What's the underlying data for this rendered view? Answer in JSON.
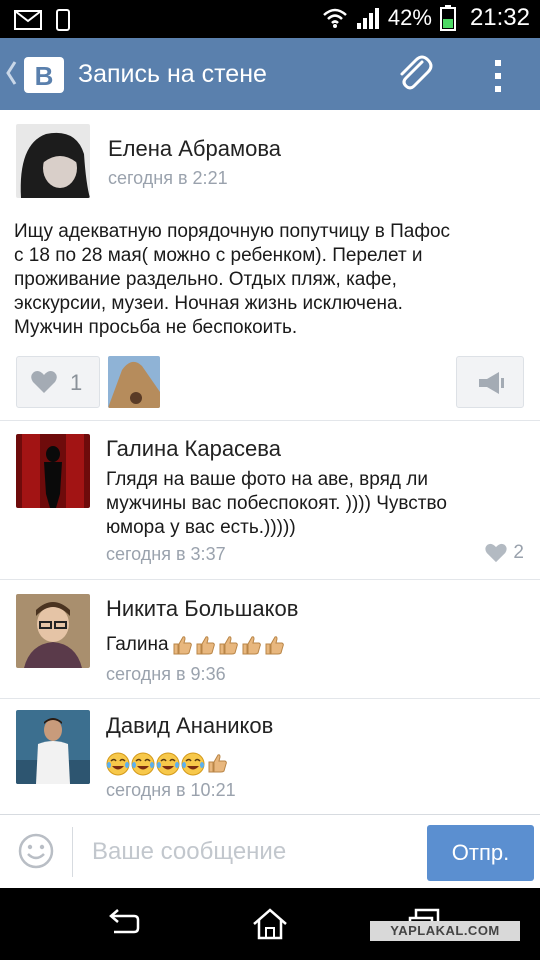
{
  "status_bar": {
    "battery": "42%",
    "clock": "21:32"
  },
  "header": {
    "title": "Запись на стене",
    "logo_letter": "B"
  },
  "post": {
    "author": "Елена Абрамова",
    "time": "сегодня в 2:21",
    "text_lines": [
      "Ищу адекватную порядочную попутчицу в Пафос",
      "с 18 по 28 мая( можно с ребенком). Перелет и",
      "проживание раздельно. Отдых пляж, кафе,",
      "экскурсии, музеи.  Ночная жизнь исключена.",
      "Мужчин просьба не беспокоить."
    ],
    "like_count": "1"
  },
  "comments": [
    {
      "author": "Галина Карасева",
      "text_lines": [
        "Глядя на ваше фото на аве, вряд ли",
        "мужчины вас побеспокоят. )))) Чувство",
        "юмора у вас есть.)))))"
      ],
      "time": "сегодня в 3:37",
      "likes": "2"
    },
    {
      "author": "Никита Большаков",
      "text": "Галина",
      "emoji": [
        "thumbs-up",
        "thumbs-up",
        "thumbs-up",
        "thumbs-up",
        "thumbs-up"
      ],
      "time": "сегодня в 9:36"
    },
    {
      "author": "Давид Анаников",
      "emoji": [
        "tears-of-joy",
        "tears-of-joy",
        "tears-of-joy",
        "tears-of-joy",
        "thumbs-up"
      ],
      "time": "сегодня в 10:21"
    }
  ],
  "composer": {
    "placeholder": "Ваше сообщение",
    "send_label": "Отпр."
  },
  "watermark": "YAPLAKAL.COM",
  "colors": {
    "header": "#5a80ad",
    "send_button": "#5b8fd0",
    "meta_text": "#9aa2ad"
  }
}
